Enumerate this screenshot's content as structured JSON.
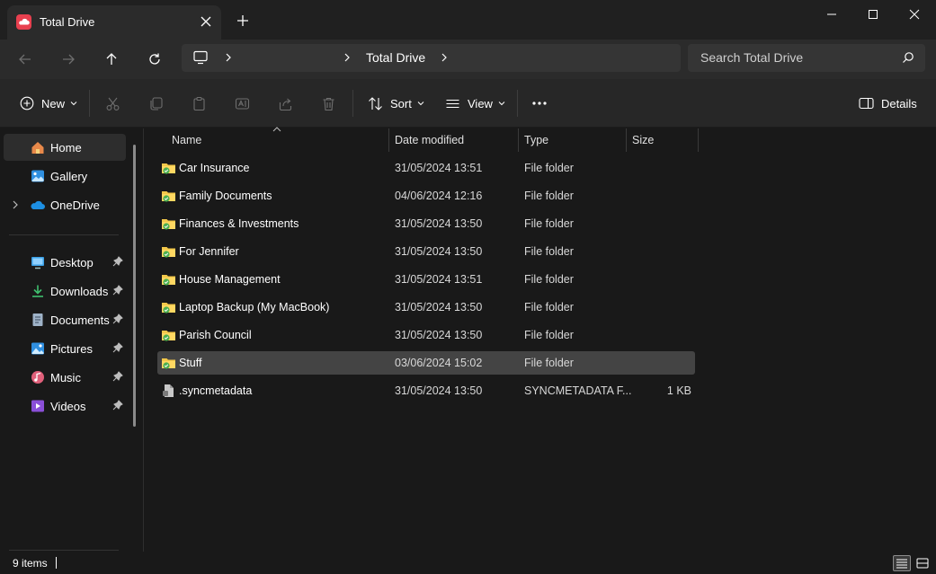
{
  "window": {
    "tab_title": "Total Drive",
    "colors": {
      "accent": "#e8404f",
      "folder": "#f3c84a",
      "sync": "#4caf50"
    }
  },
  "address": {
    "crumbs": [
      "Total Drive"
    ],
    "search_placeholder": "Search Total Drive"
  },
  "commands": {
    "new_label": "New",
    "sort_label": "Sort",
    "view_label": "View",
    "details_label": "Details",
    "icons": [
      "plus-icon",
      "cut-icon",
      "copy-icon",
      "paste-icon",
      "rename-icon",
      "share-icon",
      "delete-icon",
      "sort-icon",
      "view-icon",
      "more-icon",
      "details-icon"
    ]
  },
  "sidebar": {
    "items": [
      {
        "label": "Home",
        "icon": "home-icon",
        "active": true
      },
      {
        "label": "Gallery",
        "icon": "gallery-icon"
      },
      {
        "label": "OneDrive",
        "icon": "cloud-icon",
        "expandable": true
      }
    ],
    "quick_access": [
      {
        "label": "Desktop",
        "icon": "desktop-icon",
        "pinned": true
      },
      {
        "label": "Downloads",
        "icon": "download-icon",
        "pinned": true
      },
      {
        "label": "Documents",
        "icon": "document-icon",
        "pinned": true
      },
      {
        "label": "Pictures",
        "icon": "pictures-icon",
        "pinned": true
      },
      {
        "label": "Music",
        "icon": "music-icon",
        "pinned": true
      },
      {
        "label": "Videos",
        "icon": "videos-icon",
        "pinned": true
      }
    ]
  },
  "columns": [
    "Name",
    "Date modified",
    "Type",
    "Size"
  ],
  "files": [
    {
      "name": "Car Insurance",
      "date": "31/05/2024 13:51",
      "type": "File folder",
      "size": ""
    },
    {
      "name": "Family Documents",
      "date": "04/06/2024 12:16",
      "type": "File folder",
      "size": ""
    },
    {
      "name": "Finances & Investments",
      "date": "31/05/2024 13:50",
      "type": "File folder",
      "size": ""
    },
    {
      "name": "For Jennifer",
      "date": "31/05/2024 13:50",
      "type": "File folder",
      "size": ""
    },
    {
      "name": "House Management",
      "date": "31/05/2024 13:51",
      "type": "File folder",
      "size": ""
    },
    {
      "name": "Laptop Backup (My MacBook)",
      "date": "31/05/2024 13:50",
      "type": "File folder",
      "size": ""
    },
    {
      "name": "Parish Council",
      "date": "31/05/2024 13:50",
      "type": "File folder",
      "size": ""
    },
    {
      "name": "Stuff",
      "date": "03/06/2024 15:02",
      "type": "File folder",
      "size": "",
      "selected": true
    },
    {
      "name": ".syncmetadata",
      "date": "31/05/2024 13:50",
      "type": "SYNCMETADATA F...",
      "size": "1 KB",
      "is_file": true
    }
  ],
  "status": {
    "item_count": "9 items"
  }
}
